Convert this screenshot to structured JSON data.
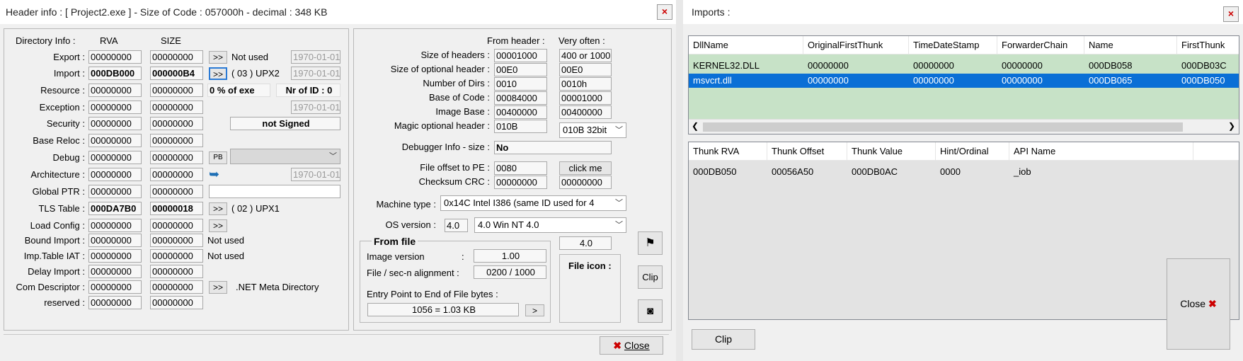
{
  "header_window": {
    "title": "Header info  : [ Project2.exe ] - Size of Code : 057000h - decimal : 348 KB",
    "close_x": "×",
    "dir_title": "Directory Info :",
    "col_rva": "RVA",
    "col_size": "SIZE",
    "dirs": [
      {
        "label": "Export :",
        "rva": "00000000",
        "size": "00000000",
        "extra": "Not used",
        "date": "1970-01-01"
      },
      {
        "label": "Import :",
        "rva": "000DB000",
        "size": "000000B4",
        "extra": "( 03 ) UPX2",
        "date": "1970-01-01"
      },
      {
        "label": "Resource :",
        "rva": "00000000",
        "size": "00000000",
        "extra": "0  % of exe",
        "extra2": "Nr of ID : 0"
      },
      {
        "label": "Exception :",
        "rva": "00000000",
        "size": "00000000",
        "date": "1970-01-01"
      },
      {
        "label": "Security :",
        "rva": "00000000",
        "size": "00000000",
        "extra": "not Signed"
      },
      {
        "label": "Base Reloc :",
        "rva": "00000000",
        "size": "00000000"
      },
      {
        "label": "Debug :",
        "rva": "00000000",
        "size": "00000000",
        "extra": "PB"
      },
      {
        "label": "Architecture :",
        "rva": "00000000",
        "size": "00000000",
        "date": "1970-01-01"
      },
      {
        "label": "Global PTR :",
        "rva": "00000000",
        "size": "00000000"
      },
      {
        "label": "TLS Table :",
        "rva": "000DA7B0",
        "size": "00000018",
        "extra": "( 02 ) UPX1"
      },
      {
        "label": "Load Config :",
        "rva": "00000000",
        "size": "00000000"
      },
      {
        "label": "Bound Import :",
        "rva": "00000000",
        "size": "00000000",
        "extra": "Not used"
      },
      {
        "label": "Imp.Table IAT :",
        "rva": "00000000",
        "size": "00000000",
        "extra": "Not used"
      },
      {
        "label": "Delay Import :",
        "rva": "00000000",
        "size": "00000000"
      },
      {
        "label": "Com Descriptor :",
        "rva": "00000000",
        "size": "00000000",
        "extra": ".NET Meta Directory"
      },
      {
        "label": "reserved :",
        "rva": "00000000",
        "size": "00000000"
      }
    ],
    "btn_more": ">>",
    "right": {
      "from_header": "From header :",
      "very_often": "Very often :",
      "rows": [
        {
          "label": "Size of headers :",
          "val": "00001000",
          "often": "400 or 1000"
        },
        {
          "label": "Size of optional header :",
          "val": "00E0",
          "often": "00E0"
        },
        {
          "label": "Number of Dirs :",
          "val": "0010",
          "often": "0010h"
        },
        {
          "label": "Base of Code :",
          "val": "00084000",
          "often": "00001000"
        },
        {
          "label": "Image Base :",
          "val": "00400000",
          "often": "00400000"
        },
        {
          "label": "Magic optional header :",
          "val": "010B",
          "often": "010B 32bit"
        }
      ],
      "debugger_label": "Debugger Info  - size :",
      "debugger_val": "No",
      "file_offset_label": "File offset to PE :",
      "file_offset_val": "0080",
      "click_me": "click me",
      "checksum_label": "Checksum CRC :",
      "checksum_val": "00000000",
      "checksum_often": "00000000",
      "machine_label": "Machine type :",
      "machine_val": "0x14C    Intel I386 (same ID used for 4",
      "os_label": "OS version :",
      "os_val": "4.0",
      "os_combo": "4.0   Win NT 4.0",
      "os_often": "4.0",
      "from_file": "From file",
      "image_version_label": "Image version",
      "image_version_colon": ":",
      "image_version_val": "1.00",
      "align_label": "File / sec-n alignment  :",
      "align_val": "0200   /   1000",
      "entry_label": "Entry Point to End of File bytes :",
      "entry_val": "1056  =  1.03 KB",
      "entry_btn": ">",
      "file_icon": "File icon :",
      "clip": "Clip",
      "close": "Close"
    }
  },
  "imports_window": {
    "title": "Imports :",
    "close_x": "×",
    "dll_columns": [
      "DllName",
      "OriginalFirstThunk",
      "TimeDateStamp",
      "ForwarderChain",
      "Name",
      "FirstThunk"
    ],
    "dll_rows": [
      [
        "KERNEL32.DLL",
        "00000000",
        "00000000",
        "00000000",
        "000DB058",
        "000DB03C"
      ],
      [
        "msvcrt.dll",
        "00000000",
        "00000000",
        "00000000",
        "000DB065",
        "000DB050"
      ]
    ],
    "thunk_columns": [
      "Thunk RVA",
      "Thunk Offset",
      "Thunk Value",
      "Hint/Ordinal",
      "API Name"
    ],
    "thunk_rows": [
      [
        "000DB050",
        "00056A50",
        "000DB0AC",
        "0000",
        "_iob"
      ]
    ],
    "clip": "Clip",
    "close": "Close"
  },
  "colors": {
    "selection": "#0a6fd6",
    "dll_bg": "#c7e2c7",
    "close_red": "#cc0000"
  }
}
